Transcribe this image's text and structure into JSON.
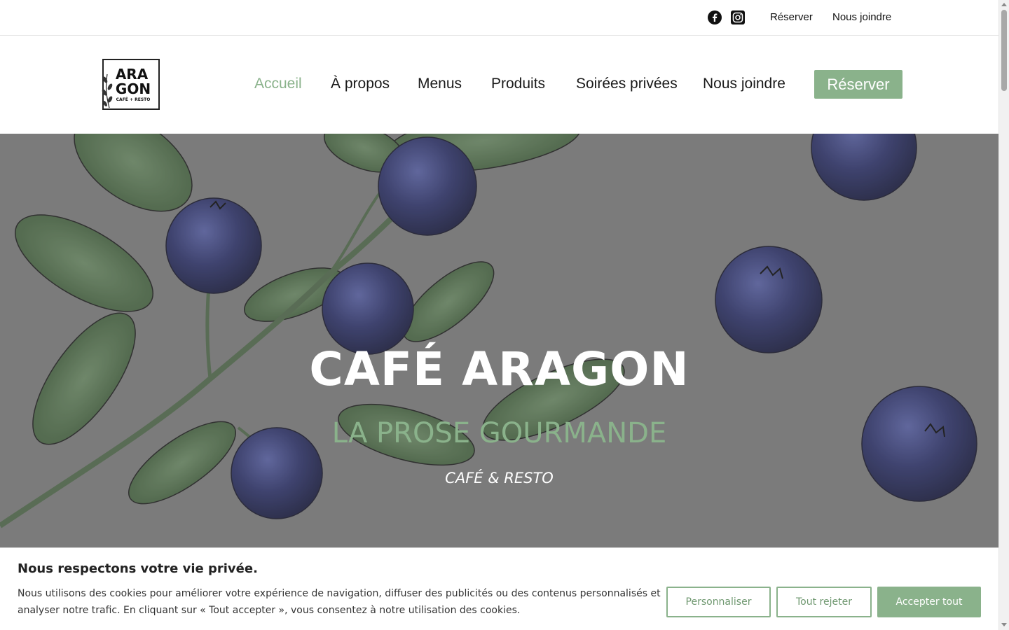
{
  "topbar": {
    "social": [
      {
        "icon": "facebook-icon"
      },
      {
        "icon": "instagram-icon"
      }
    ],
    "links": [
      "Réserver",
      "Nous joindre"
    ]
  },
  "header": {
    "logo": {
      "line1": "ARA",
      "line2": "GON",
      "line3": "CAFÉ + RESTO"
    },
    "nav": [
      "Accueil",
      "À propos",
      "Menus",
      "Produits",
      "Soirées privées",
      "Nous joindre"
    ],
    "active_nav": "Accueil",
    "cta": "Réserver"
  },
  "hero": {
    "title": "CAFÉ ARAGON",
    "subtitle": "LA PROSE GOURMANDE",
    "tagline": "CAFÉ & RESTO"
  },
  "cookie": {
    "title": "Nous respectons votre vie privée.",
    "text": "Nous utilisons des cookies pour améliorer votre expérience de navigation, diffuser des publicités ou des contenus personnalisés et analyser notre trafic. En cliquant sur « Tout accepter », vous consentez à notre utilisation des cookies.",
    "buttons": {
      "customize": "Personnaliser",
      "reject": "Tout rejeter",
      "accept": "Accepter tout"
    }
  },
  "colors": {
    "accent": "#8ab28b",
    "hero_overlay": "#7b7b7b",
    "berry": "#2f3566",
    "leaf": "#4f6e4a"
  }
}
